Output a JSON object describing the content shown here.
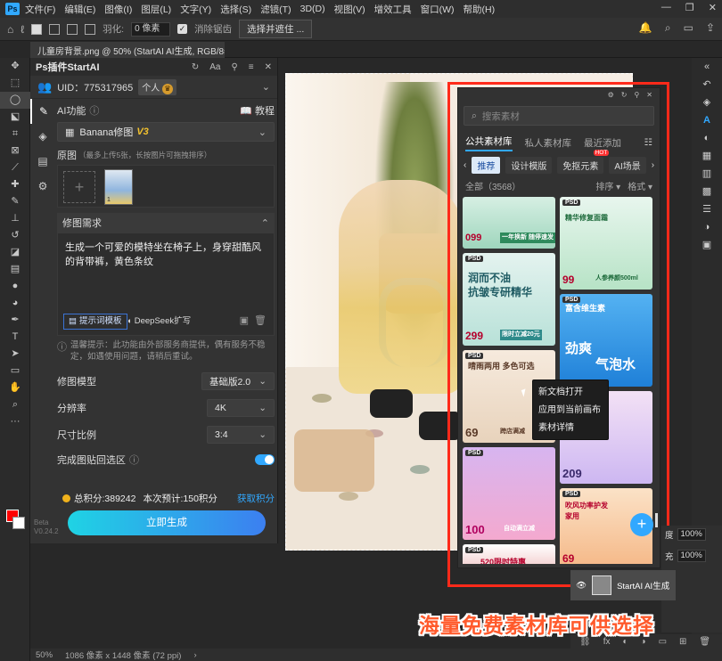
{
  "menu": [
    "文件(F)",
    "编辑(E)",
    "图像(I)",
    "图层(L)",
    "文字(Y)",
    "选择(S)",
    "滤镜(T)",
    "3D(D)",
    "视图(V)",
    "增效工具",
    "窗口(W)",
    "帮助(H)"
  ],
  "options": {
    "feather_label": "羽化:",
    "feather_value": "0 像素",
    "antialias_label": "消除锯齿",
    "select_mask_btn": "选择并遮住 ..."
  },
  "doc_tab": "儿童房背景.png @ 50% (StartAI AI生成, RGB/8#) *",
  "plugin": {
    "title": "Ps插件StartAI",
    "uid": "UID：775317965",
    "account_type": "个人",
    "ai_function_label": "AI功能",
    "tutorial": "教程",
    "model_select": "Banana修图",
    "model_version": "V3",
    "source_label": "原图",
    "source_hint": "（最多上传5张，长按图片可拖拽排序）",
    "thumb_index": "1",
    "edit_req_label": "修图需求",
    "prompt": "生成一个可爱的模特坐在椅子上，身穿甜酷风的背带裤，黄色条纹",
    "prompt_template_btn": "提示词模板",
    "deepseek_btn": "DeepSeek扩写",
    "tip": "温馨提示：此功能由外部服务商提供，偶有服务不稳定，如遇使用问题，请稍后重试。",
    "model_label": "修图模型",
    "model_value": "基础版2.0",
    "resolution_label": "分辨率",
    "resolution_value": "4K",
    "ratio_label": "尺寸比例",
    "ratio_value": "3:4",
    "paste_back_label": "完成图贴回选区",
    "paste_back_on": true,
    "points_total": "总积分:389242",
    "points_estimate": "本次预计:150积分",
    "get_points": "获取积分",
    "generate_btn": "立即生成",
    "beta": "Beta",
    "version": "V0.24.2"
  },
  "materials": {
    "search_placeholder": "搜索素材",
    "tabs": [
      "公共素材库",
      "私人素材库",
      "最近添加"
    ],
    "categories": [
      "推荐",
      "设计模版",
      "免抠元素",
      "AI场景"
    ],
    "hot_tag": "HOT",
    "count": "全部（3568）",
    "sort": "排序",
    "format": "格式",
    "cards": {
      "c1_price": "099",
      "c1_text": "一年换新 随停速发",
      "c2_title": "润而不油",
      "c2_sub": "抗皱专研精华",
      "c2_price": "299",
      "c2_off": "限时立减20元",
      "c3_title": "晴雨两用 多色可选",
      "c3_price": "69",
      "c3_foot": "跨店满减",
      "c4_title": "精华修复面霜",
      "c4_price": "99",
      "c4_foot": "人参养颜500ml",
      "c5_title": "富含维生素",
      "c5_big": "劲爽",
      "c5_big2": "气泡水",
      "c5_price": "209",
      "c6_price": "100",
      "c6_foot": "自动满立减",
      "c7_title": "吹风功率护发家用",
      "c7_price": "69",
      "c8_title": "520限时特惠",
      "psd": "PSD"
    },
    "context_menu": [
      "新文档打开",
      "应用到当前画布",
      "素材详情"
    ]
  },
  "layers": {
    "opacity": "100%",
    "fill": "100%",
    "layer_name": "StartAI AI生成"
  },
  "status": {
    "zoom": "50%",
    "size": "1086 像素 x 1448 像素 (72 ppi)"
  },
  "caption": "海量免费素材库可供选择",
  "colors": {
    "accent": "#31a8ff",
    "frame": "#ff2a1a",
    "caption": "#ff5a2c",
    "foreground": "#ff0000"
  }
}
